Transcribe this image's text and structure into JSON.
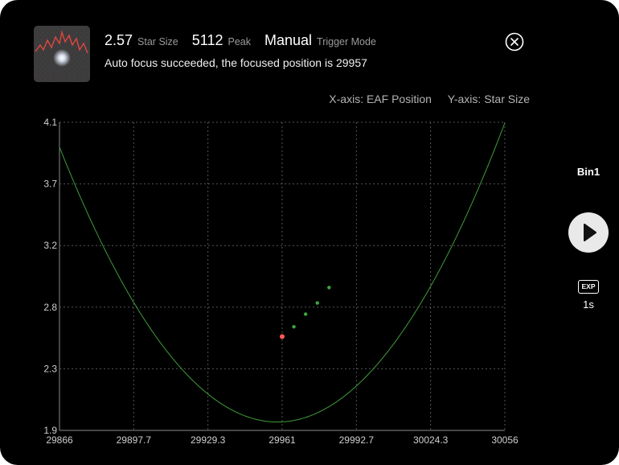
{
  "header": {
    "star_size_value": "2.57",
    "star_size_label": "Star Size",
    "peak_value": "5112",
    "peak_label": "Peak",
    "trigger_value": "Manual",
    "trigger_label": "Trigger Mode",
    "status_message": "Auto focus succeeded, the focused position is 29957",
    "close_icon": "close-circle-icon"
  },
  "axes_info": {
    "x_axis": "X-axis: EAF Position",
    "y_axis": "Y-axis: Star Size"
  },
  "side_panel": {
    "bin_label": "Bin1",
    "play_icon": "play-icon",
    "exposure_icon_label": "EXP",
    "exposure_time": "1s"
  },
  "colors": {
    "background": "#000000",
    "curve": "#3f9c3a",
    "point": "#3aa83a",
    "focus_point": "#ff5a5a",
    "grid": "#555555"
  },
  "chart_data": {
    "type": "scatter",
    "xlim": [
      29866,
      30056
    ],
    "ylim": [
      1.9,
      4.1
    ],
    "x_ticks": [
      "29866",
      "29897.7",
      "29929.3",
      "29961",
      "29992.7",
      "30024.3",
      "30056"
    ],
    "y_ticks": [
      "4.1",
      "3.7",
      "3.2",
      "2.8",
      "2.3",
      "1.9"
    ],
    "grid": true,
    "fit_curve": {
      "vertex_x": 29959,
      "vertex_y": 1.96,
      "coefficient": 0.000227
    },
    "points": [
      {
        "x": 29966,
        "y": 2.64
      },
      {
        "x": 29971,
        "y": 2.73
      },
      {
        "x": 29976,
        "y": 2.81
      },
      {
        "x": 29981,
        "y": 2.92
      }
    ],
    "focus_point": {
      "x": 29961,
      "y": 2.57
    }
  }
}
